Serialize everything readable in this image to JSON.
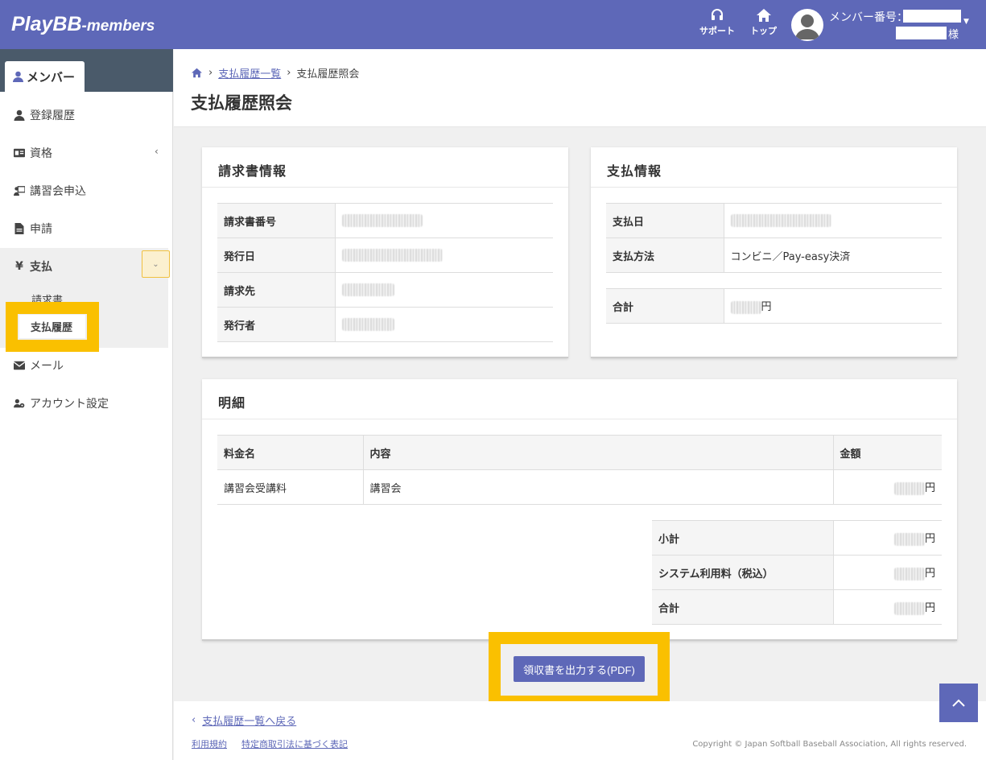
{
  "header": {
    "logo_main": "PlayBB",
    "logo_sub": "-members",
    "support_label": "サポート",
    "top_label": "トップ",
    "member_number_label": "メンバー番号：",
    "honorific": "様"
  },
  "sidebar": {
    "tab_label": "メンバー",
    "items": [
      {
        "label": "登録履歴",
        "icon": "user-icon"
      },
      {
        "label": "資格",
        "icon": "id-card-icon"
      },
      {
        "label": "講習会申込",
        "icon": "presentation-icon"
      },
      {
        "label": "申請",
        "icon": "file-icon"
      },
      {
        "label": "支払",
        "icon": "yen-icon"
      },
      {
        "label": "メール",
        "icon": "envelope-icon"
      },
      {
        "label": "アカウント設定",
        "icon": "user-gear-icon"
      }
    ],
    "payment_sub": [
      "請求書",
      "支払履歴"
    ]
  },
  "breadcrumb": {
    "list_link": "支払履歴一覧",
    "current": "支払履歴照会"
  },
  "page_title": "支払履歴照会",
  "invoice_card": {
    "title": "請求書情報",
    "rows": [
      {
        "label": "請求書番号"
      },
      {
        "label": "発行日"
      },
      {
        "label": "請求先"
      },
      {
        "label": "発行者"
      }
    ]
  },
  "payment_card": {
    "title": "支払情報",
    "date_label": "支払日",
    "method_label": "支払方法",
    "method_value": "コンビニ／Pay-easy決済",
    "total_label": "合計",
    "currency": "円"
  },
  "detail_card": {
    "title": "明細",
    "columns": [
      "料金名",
      "内容",
      "金額"
    ],
    "rows": [
      {
        "name": "講習会受講料",
        "content": "講習会",
        "currency": "円"
      }
    ],
    "summary": [
      {
        "label": "小計",
        "currency": "円"
      },
      {
        "label": "システム利用料（税込）",
        "currency": "円"
      },
      {
        "label": "合計",
        "currency": "円"
      }
    ]
  },
  "pdf_button": "領収書を出力する(PDF)",
  "footer": {
    "back_link": "支払履歴一覧へ戻る",
    "terms": "利用規約",
    "tokusho": "特定商取引法に基づく表記",
    "copyright": "Copyright © Japan Softball Baseball Association, All rights reserved."
  },
  "colors": {
    "brand": "#5e68b8",
    "highlight": "#fac000",
    "sidebar_dark": "#4a5a6a"
  }
}
